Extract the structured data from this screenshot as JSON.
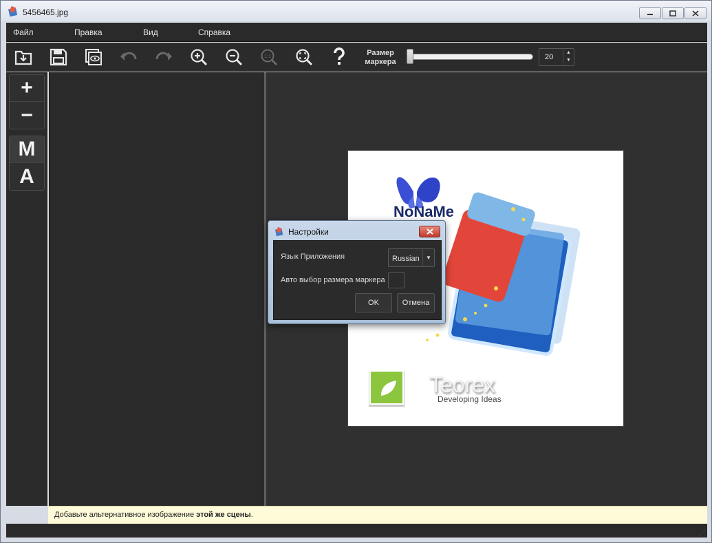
{
  "window": {
    "title": "5456465.jpg"
  },
  "menu": {
    "items": [
      "Файл",
      "Правка",
      "Вид",
      "Справка"
    ]
  },
  "toolbar": {
    "marker_size_label_line1": "Размер",
    "marker_size_label_line2": "маркера",
    "marker_size_value": "20",
    "slider_level": 0.0
  },
  "tools": {
    "add": "+",
    "remove": "−",
    "manual": "M",
    "auto": "A"
  },
  "preview": {
    "logo1_text": "NoNaMe",
    "logo2_name": "Teorex",
    "logo2_tagline": "Developing Ideas"
  },
  "status": {
    "text_prefix": "Добавьте альтернативное изображение ",
    "text_bold": "этой же сцены",
    "text_suffix": "."
  },
  "dialog": {
    "title": "Настройки",
    "language_label": "Язык Приложения",
    "language_value": "Russian",
    "auto_marker_label": "Авто выбор размера маркера",
    "ok_label": "OK",
    "cancel_label": "Отмена"
  },
  "colors": {
    "chrome_dark": "#2b2b2b",
    "canvas": "#303030",
    "status_bg": "#fffbd9",
    "dialog_frame": "#b7c9df"
  }
}
